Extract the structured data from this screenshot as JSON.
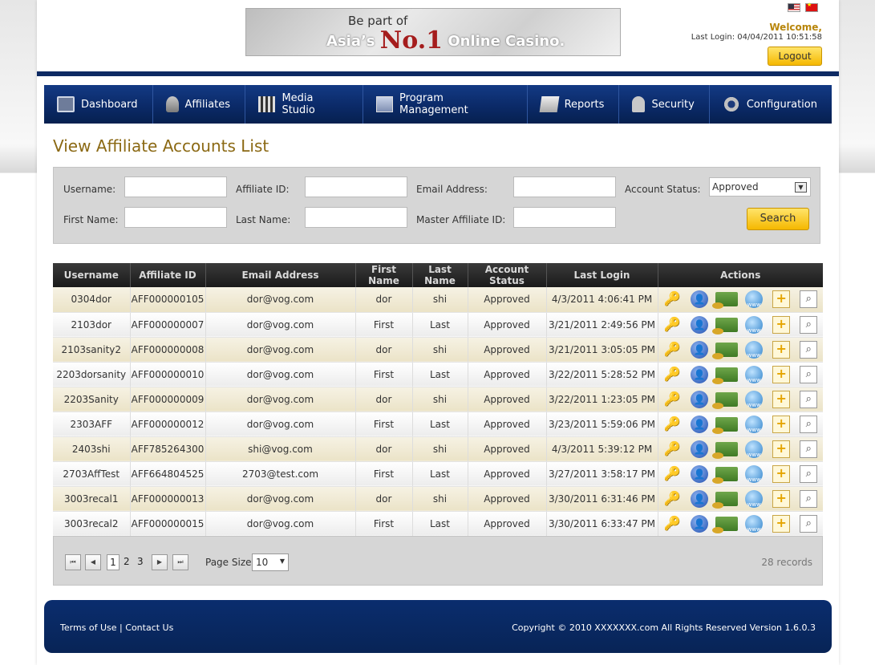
{
  "header": {
    "banner_line1": "Be part of",
    "banner_asia": "Asia’s",
    "banner_no1": "No.1",
    "banner_rest": "Online Casino.",
    "welcome": "Welcome,",
    "last_login": "Last Login: 04/04/2011 10:51:58",
    "logout_label": "Logout"
  },
  "nav": [
    {
      "label": "Dashboard",
      "icon": "dashboard-icon"
    },
    {
      "label": "Affiliates",
      "icon": "affiliates-icon"
    },
    {
      "label": "Media Studio",
      "icon": "clapperboard-icon"
    },
    {
      "label": "Program Management",
      "icon": "program-icon"
    },
    {
      "label": "Reports",
      "icon": "report-icon"
    },
    {
      "label": "Security",
      "icon": "lock-icon"
    },
    {
      "label": "Configuration",
      "icon": "gear-icon"
    }
  ],
  "page_title": "View Affiliate Accounts List",
  "search": {
    "username_label": "Username:",
    "affiliate_id_label": "Affiliate ID:",
    "email_label": "Email Address:",
    "status_label": "Account Status:",
    "status_value": "Approved",
    "first_name_label": "First Name:",
    "last_name_label": "Last Name:",
    "master_label": "Master Affiliate ID:",
    "search_label": "Search"
  },
  "table": {
    "headers": [
      "Username",
      "Affiliate ID",
      "Email Address",
      "First Name",
      "Last Name",
      "Account Status",
      "Last Login",
      "Actions"
    ],
    "rows": [
      [
        "0304dor",
        "AFF000000105",
        "dor@vog.com",
        "dor",
        "shi",
        "Approved",
        "4/3/2011 4:06:41 PM"
      ],
      [
        "2103dor",
        "AFF000000007",
        "dor@vog.com",
        "First",
        "Last",
        "Approved",
        "3/21/2011 2:49:56 PM"
      ],
      [
        "2103sanity2",
        "AFF000000008",
        "dor@vog.com",
        "dor",
        "shi",
        "Approved",
        "3/21/2011 3:05:05 PM"
      ],
      [
        "2203dorsanity",
        "AFF000000010",
        "dor@vog.com",
        "First",
        "Last",
        "Approved",
        "3/22/2011 5:28:52 PM"
      ],
      [
        "2203Sanity",
        "AFF000000009",
        "dor@vog.com",
        "dor",
        "shi",
        "Approved",
        "3/22/2011 1:23:05 PM"
      ],
      [
        "2303AFF",
        "AFF000000012",
        "dor@vog.com",
        "First",
        "Last",
        "Approved",
        "3/23/2011 5:59:06 PM"
      ],
      [
        "2403shi",
        "AFF785264300",
        "shi@vog.com",
        "dor",
        "shi",
        "Approved",
        "4/3/2011 5:39:12 PM"
      ],
      [
        "2703AffTest",
        "AFF664804525",
        "2703@test.com",
        "First",
        "Last",
        "Approved",
        "3/27/2011 3:58:17 PM"
      ],
      [
        "3003recal1",
        "AFF000000013",
        "dor@vog.com",
        "dor",
        "shi",
        "Approved",
        "3/30/2011 6:31:46 PM"
      ],
      [
        "3003recal2",
        "AFF000000015",
        "dor@vog.com",
        "First",
        "Last",
        "Approved",
        "3/30/2011 6:33:47 PM"
      ]
    ]
  },
  "pager": {
    "first": "⏮",
    "prev": "◀",
    "next": "▶",
    "last": "⏭",
    "pages": [
      "1",
      "2",
      "3"
    ],
    "page_size_label": "Page Size",
    "page_size_value": "10",
    "records": "28 records"
  },
  "footer": {
    "terms": "Terms of Use",
    "sep": "|",
    "contact": "Contact Us",
    "copyright": "Copyright © 2010 XXXXXXX.com All Rights Reserved  Version 1.6.0.3"
  },
  "colors": {
    "nav_bg": "#0b2a68",
    "title": "#8b6914",
    "button": "#f5b800",
    "table_header": "#1a1a1a",
    "row_odd": "#ebe3c7"
  }
}
